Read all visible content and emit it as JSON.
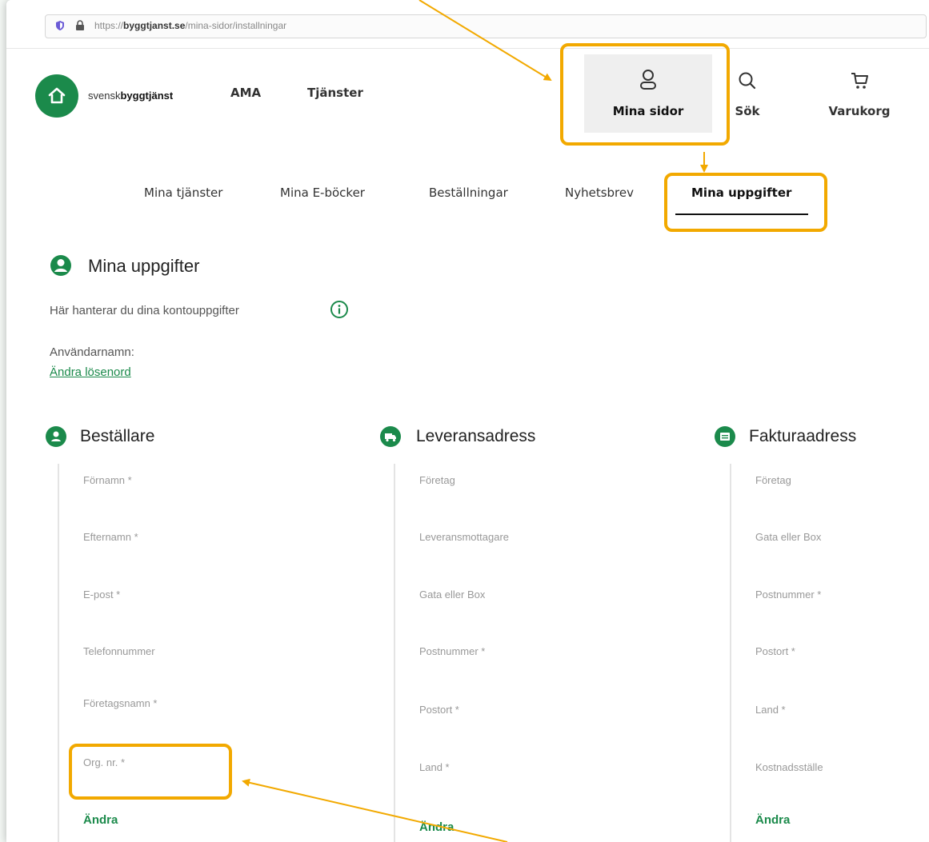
{
  "browser": {
    "url_prefix": "https://",
    "url_domain": "byggtjanst.se",
    "url_path": "/mina-sidor/installningar"
  },
  "header": {
    "logo_light": "svensk",
    "logo_bold": "byggtjänst",
    "nav": [
      "AMA",
      "Tjänster"
    ],
    "mina_sidor": "Mina sidor",
    "search": "Sök",
    "cart": "Varukorg"
  },
  "subnav": {
    "items": [
      "Mina tjänster",
      "Mina E-böcker",
      "Beställningar",
      "Nyhetsbrev",
      "Mina uppgifter"
    ],
    "active": "Mina uppgifter"
  },
  "page": {
    "title": "Mina uppgifter",
    "subtitle": "Här hanterar du dina kontouppgifter",
    "username_label": "Användarnamn:",
    "change_password": "Ändra lösenord"
  },
  "columns": [
    {
      "heading": "Beställare",
      "fields": [
        "Förnamn *",
        "Efternamn *",
        "E-post *",
        "Telefonnummer",
        "Företagsnamn *",
        "Org. nr. *"
      ],
      "edit": "Ändra"
    },
    {
      "heading": "Leveransadress",
      "fields": [
        "Företag",
        "Leveransmottagare",
        "Gata eller Box",
        "Postnummer *",
        "Postort *",
        "Land *"
      ],
      "edit": "Ändra"
    },
    {
      "heading": "Fakturaadress",
      "fields": [
        "Företag",
        "Gata eller Box",
        "Postnummer *",
        "Postort *",
        "Land *",
        "Kostnadsställe"
      ],
      "edit": "Ändra"
    }
  ],
  "colors": {
    "brand_green": "#1b8a4b",
    "annotation": "#f2a900"
  }
}
